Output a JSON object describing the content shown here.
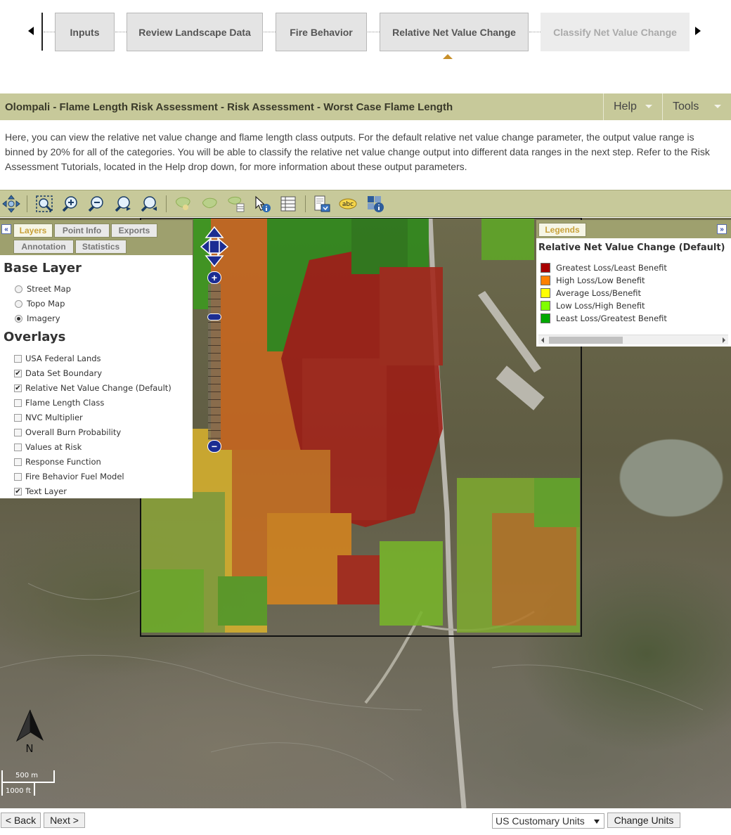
{
  "wizard": {
    "steps": [
      "Inputs",
      "Review Landscape Data",
      "Fire Behavior",
      "Relative Net Value Change",
      "Classify Net Value Change"
    ],
    "active_step": 3
  },
  "header": {
    "title": "Olompali - Flame Length Risk Assessment - Risk Assessment - Worst Case Flame Length",
    "help_label": "Help",
    "tools_label": "Tools"
  },
  "intro_text": "Here, you can view the relative net value change and flame length class outputs. For the default relative net value change parameter, the output value range is binned by 20% for all of the categories. You will be able to classify the relative net value change output into different data ranges in the next step. Refer to the Risk Assessment Tutorials, located in the Help drop down, for more information about these output parameters.",
  "toolbar": {
    "tools": [
      "pan-icon",
      "zoom-extent-icon",
      "zoom-in-icon",
      "zoom-out-icon",
      "zoom-previous-icon",
      "zoom-next-icon",
      "select-feature-icon",
      "select-area-icon",
      "select-table-icon",
      "identify-icon",
      "attribute-table-icon",
      "print-icon",
      "text-label-icon",
      "info-layers-icon"
    ]
  },
  "layers_panel": {
    "tabs": [
      "Layers",
      "Point Info",
      "Exports",
      "Annotation",
      "Statistics"
    ],
    "active_tab": "Layers",
    "base_layer_heading": "Base Layer",
    "base_layers": [
      {
        "label": "Street Map",
        "selected": false
      },
      {
        "label": "Topo Map",
        "selected": false
      },
      {
        "label": "Imagery",
        "selected": true
      }
    ],
    "overlays_heading": "Overlays",
    "overlays": [
      {
        "label": "USA Federal Lands",
        "checked": false
      },
      {
        "label": "Data Set Boundary",
        "checked": true
      },
      {
        "label": "Relative Net Value Change (Default)",
        "checked": true
      },
      {
        "label": "Flame Length Class",
        "checked": false
      },
      {
        "label": "NVC Multiplier",
        "checked": false
      },
      {
        "label": "Overall Burn Probability",
        "checked": false
      },
      {
        "label": "Values at Risk",
        "checked": false
      },
      {
        "label": "Response Function",
        "checked": false
      },
      {
        "label": "Fire Behavior Fuel Model",
        "checked": false
      },
      {
        "label": "Text Layer",
        "checked": true
      }
    ]
  },
  "legend": {
    "tab_label": "Legends",
    "title": "Relative Net Value Change (Default)",
    "items": [
      {
        "label": "Greatest Loss/Least Benefit",
        "color": "#a80000"
      },
      {
        "label": "High Loss/Low Benefit",
        "color": "#ff8000"
      },
      {
        "label": "Average Loss/Benefit",
        "color": "#ffff00"
      },
      {
        "label": "Low Loss/High Benefit",
        "color": "#80ff00"
      },
      {
        "label": "Least Loss/Greatest Benefit",
        "color": "#00a800"
      }
    ]
  },
  "map": {
    "north_label": "N",
    "scale_metric": "500 m",
    "scale_imperial": "1000 ft"
  },
  "footer": {
    "back_label": "< Back",
    "next_label": "Next >",
    "units_selected": "US Customary Units",
    "change_units_label": "Change Units"
  }
}
